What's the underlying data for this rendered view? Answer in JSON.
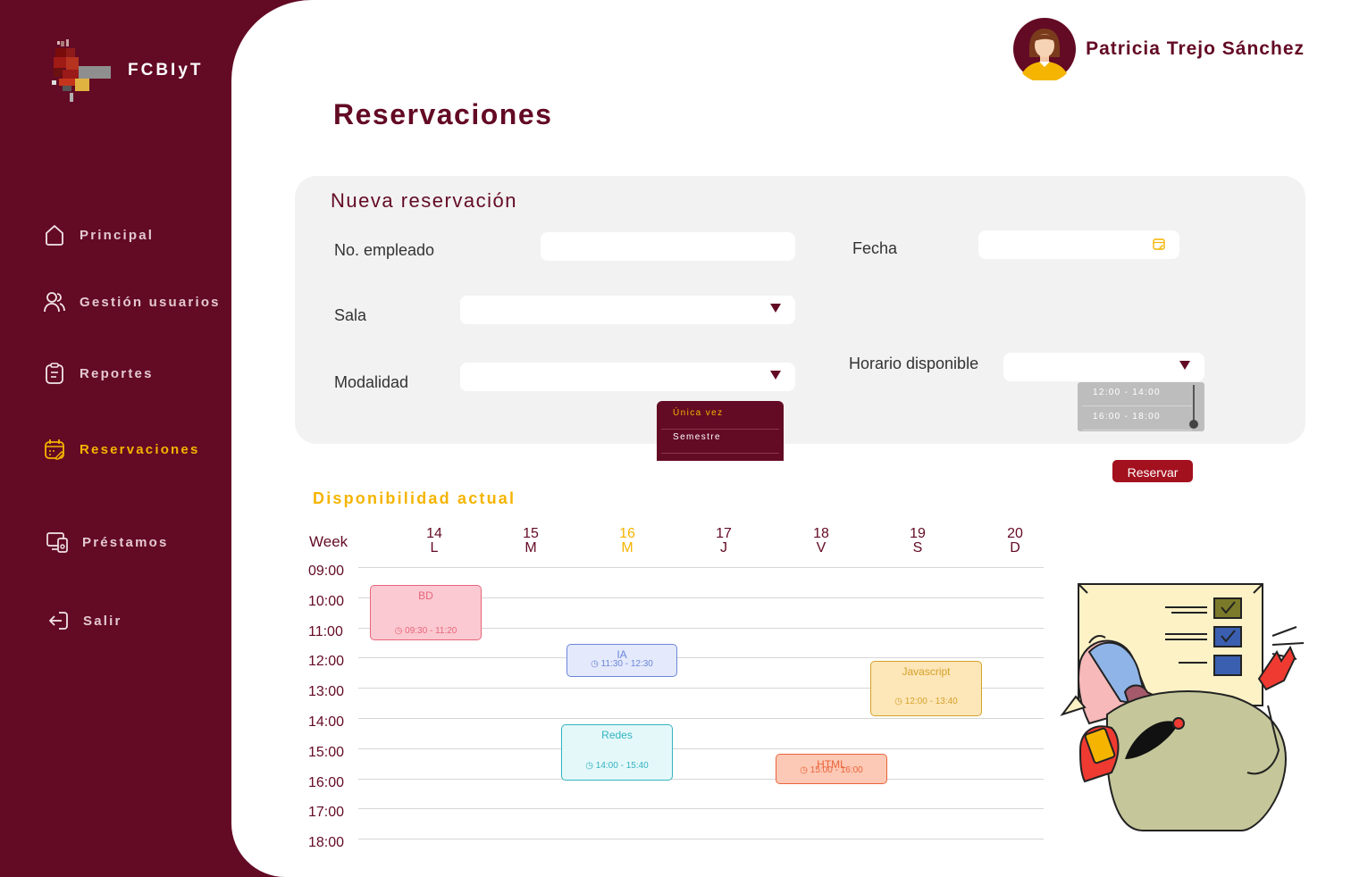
{
  "brand": {
    "name": "FCBIyT"
  },
  "sidebar": {
    "items": [
      {
        "label": "Principal",
        "icon": "home-icon"
      },
      {
        "label": "Gestión usuarios",
        "icon": "users-icon"
      },
      {
        "label": "Reportes",
        "icon": "clipboard-icon"
      },
      {
        "label": "Reservaciones",
        "icon": "calendar-edit-icon",
        "active": true
      },
      {
        "label": "Préstamos",
        "icon": "devices-icon"
      },
      {
        "label": "Salir",
        "icon": "logout-icon"
      }
    ]
  },
  "user": {
    "name": "Patricia Trejo Sánchez"
  },
  "page": {
    "title": "Reservaciones"
  },
  "form": {
    "title": "Nueva reservación",
    "employee_label": "No. empleado",
    "date_label": "Fecha",
    "room_label": "Sala",
    "mode_label": "Modalidad",
    "schedule_label": "Horario disponible",
    "mode_options": [
      "Única vez",
      "Semestre"
    ],
    "mode_selected": "Única vez",
    "schedule_options": [
      "12:00 - 14:00",
      "16:00 - 18:00"
    ],
    "submit_label": "Reservar"
  },
  "availability": {
    "title": "Disponibilidad actual",
    "week_label": "Week",
    "days": [
      {
        "num": "14",
        "letter": "L"
      },
      {
        "num": "15",
        "letter": "M"
      },
      {
        "num": "16",
        "letter": "M",
        "today": true
      },
      {
        "num": "17",
        "letter": "J"
      },
      {
        "num": "18",
        "letter": "V"
      },
      {
        "num": "19",
        "letter": "S"
      },
      {
        "num": "20",
        "letter": "D"
      }
    ],
    "hours": [
      "09:00",
      "10:00",
      "11:00",
      "12:00",
      "13:00",
      "14:00",
      "15:00",
      "16:00",
      "17:00",
      "18:00"
    ],
    "events": [
      {
        "title": "BD",
        "time": "09:30 - 11:20",
        "color": "#e8657b",
        "bg": "#fbc9d1"
      },
      {
        "title": "IA",
        "time": "11:30 - 12:30",
        "color": "#6b86d8",
        "bg": "#e4e9fb"
      },
      {
        "title": "Javascript",
        "time": "12:00 - 13:40",
        "color": "#d4a12a",
        "bg": "#fde6b8"
      },
      {
        "title": "Redes",
        "time": "14:00 - 15:40",
        "color": "#33b3c0",
        "bg": "#e4f8fa"
      },
      {
        "title": "HTML",
        "time": "15:00 - 16:00",
        "color": "#e9643a",
        "bg": "#fcc9b6"
      }
    ]
  },
  "colors": {
    "primary": "#630a24",
    "accent": "#f5b400",
    "button": "#a3101e"
  }
}
